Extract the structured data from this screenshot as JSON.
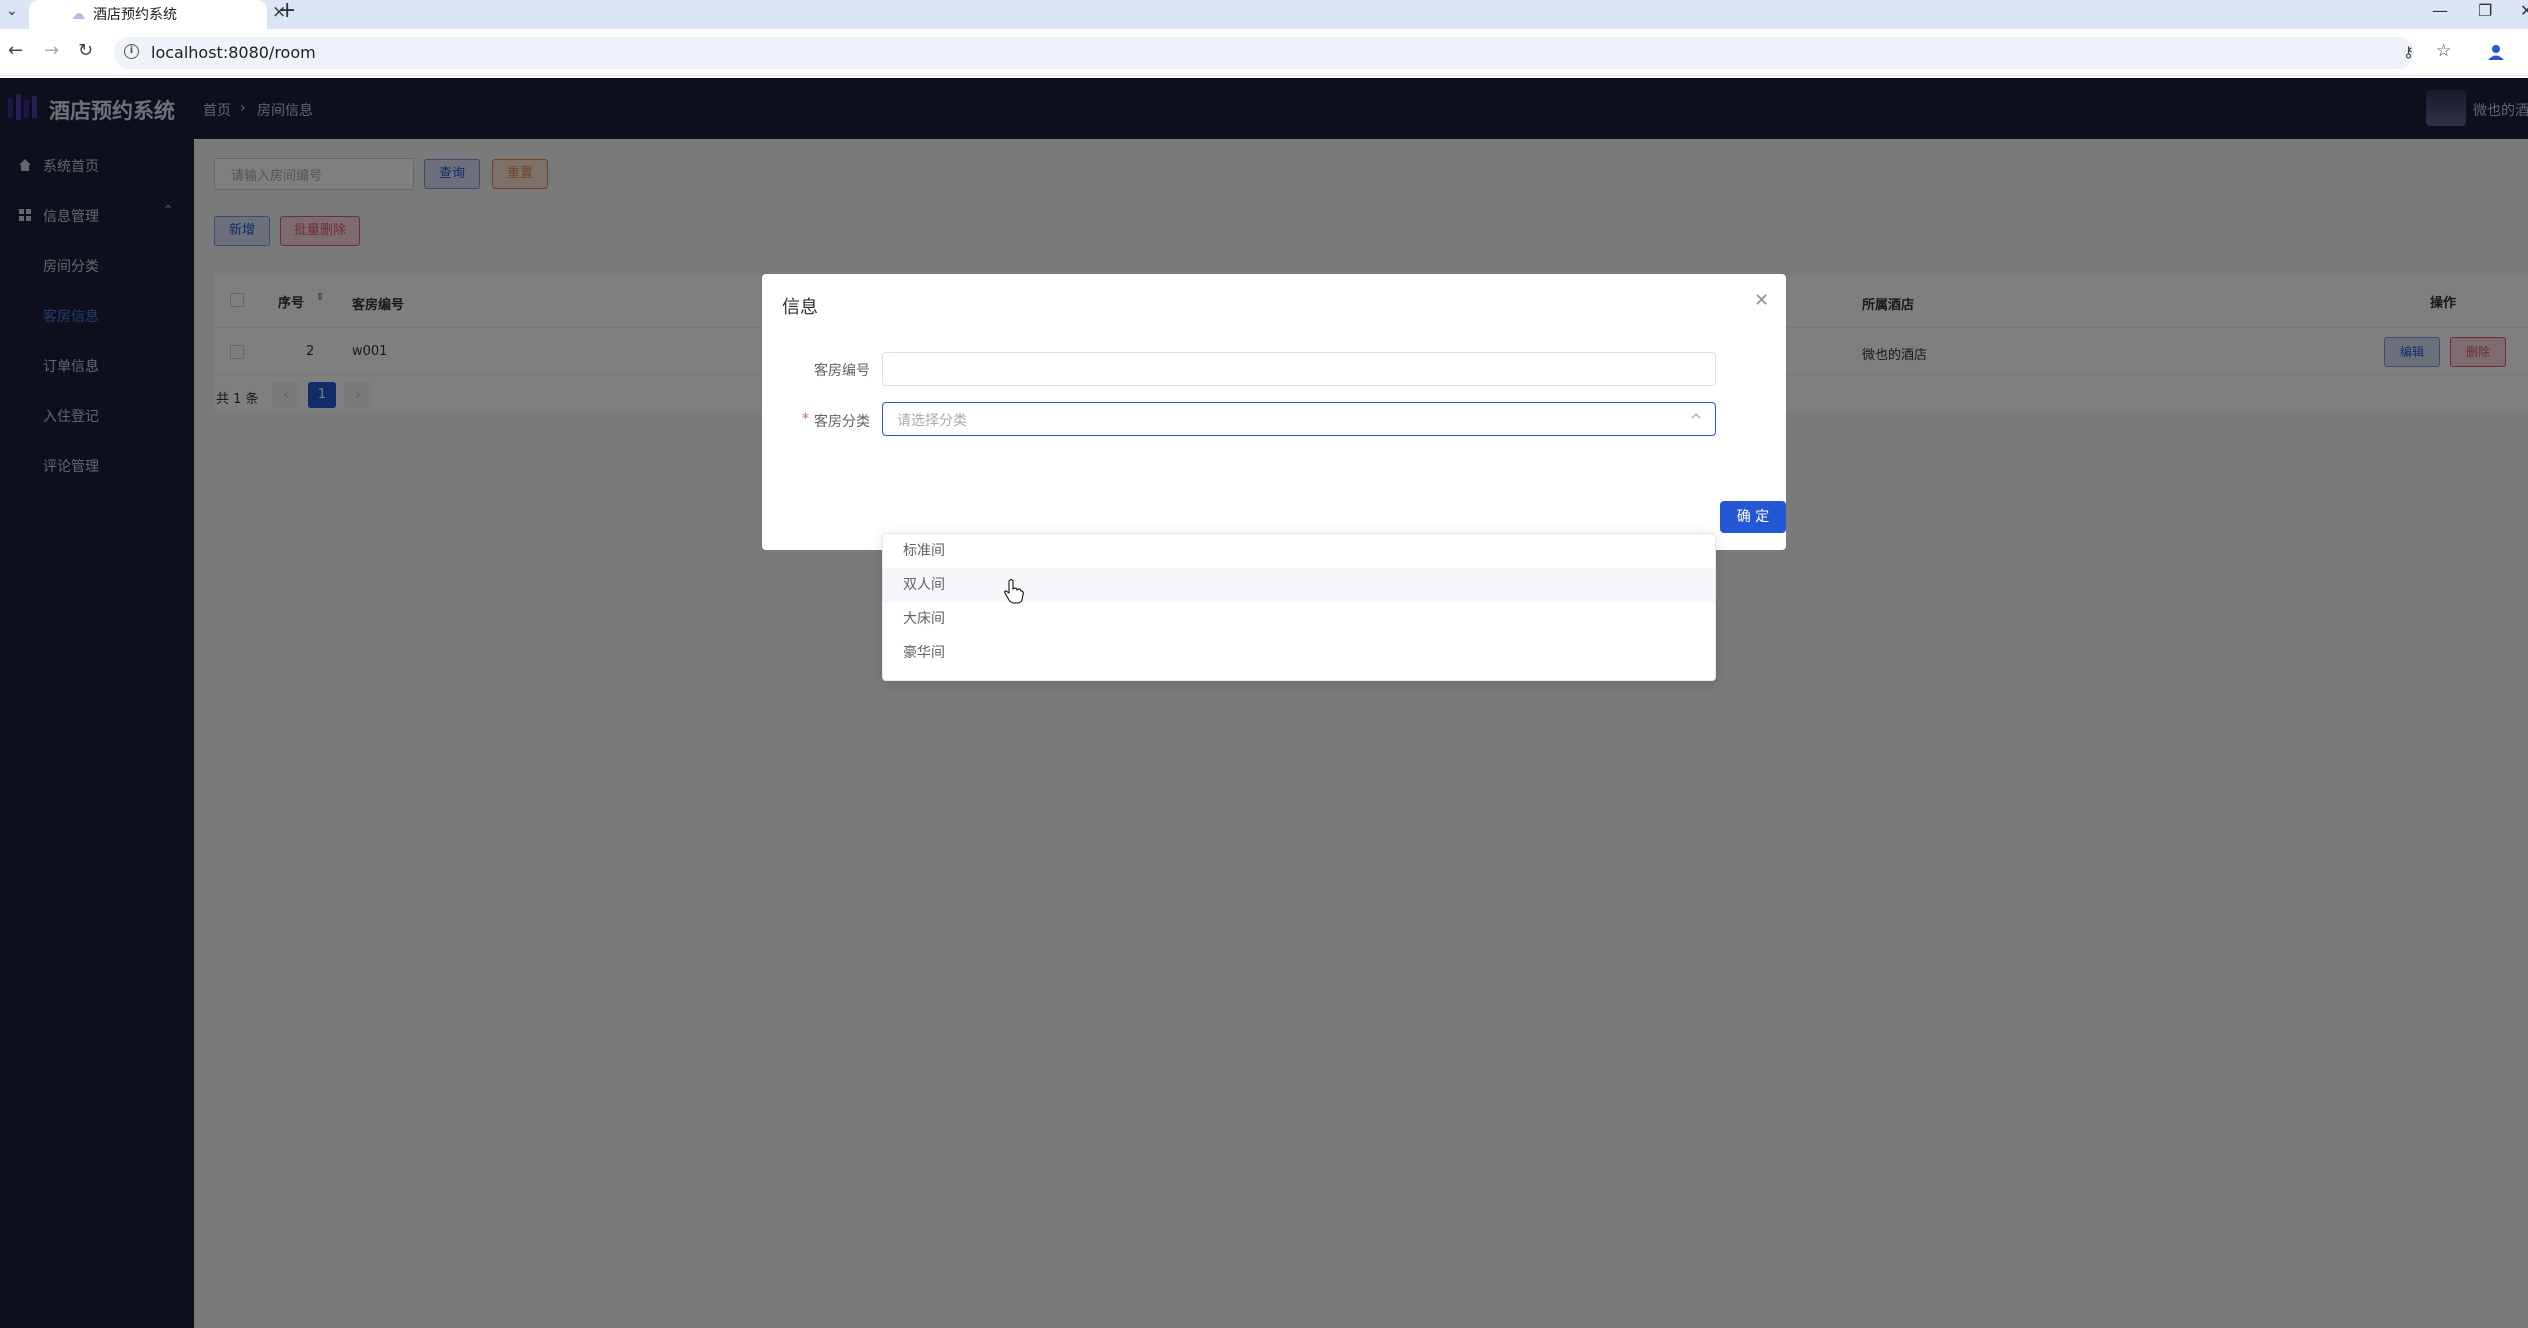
{
  "browser": {
    "tab_title": "酒店预约系统",
    "url": "localhost:8080/room"
  },
  "app": {
    "logo_text": "酒店预约系统",
    "breadcrumb": {
      "home": "首页",
      "separator": "›",
      "current": "房间信息"
    },
    "user_name": "微也的酒店"
  },
  "sidebar": {
    "items": [
      {
        "label": "系统首页",
        "icon": "home-icon"
      },
      {
        "label": "信息管理",
        "icon": "grid-icon"
      },
      {
        "label": "房间分类"
      },
      {
        "label": "客房信息",
        "active": true
      },
      {
        "label": "订单信息"
      },
      {
        "label": "入住登记"
      },
      {
        "label": "评论管理"
      }
    ]
  },
  "toolbar": {
    "search_placeholder": "请输入房间编号",
    "query_label": "查询",
    "reset_label": "重置",
    "add_label": "新增",
    "batch_delete_label": "批量删除"
  },
  "table": {
    "headers": {
      "index": "序号",
      "room_number": "客房编号",
      "hotel": "所属酒店",
      "actions": "操作"
    },
    "rows": [
      {
        "index": "2",
        "room_number": "w001",
        "hotel": "微也的酒店",
        "edit": "编辑",
        "delete": "删除"
      }
    ],
    "pagination": {
      "total": "共 1 条",
      "page": "1"
    }
  },
  "modal": {
    "title": "信息",
    "fields": {
      "room_number_label": "客房编号",
      "room_number_value": "",
      "required_mark": "*",
      "category_label": "客房分类",
      "category_placeholder": "请选择分类"
    },
    "confirm_label": "确 定",
    "dropdown_options": [
      "标准间",
      "双人间",
      "大床间",
      "豪华间"
    ],
    "hovered_option_index": 1
  },
  "colors": {
    "primary": "#2458d3",
    "header_bg": "#1a1f3b",
    "danger": "#e05a78",
    "warning": "#e8864d"
  }
}
